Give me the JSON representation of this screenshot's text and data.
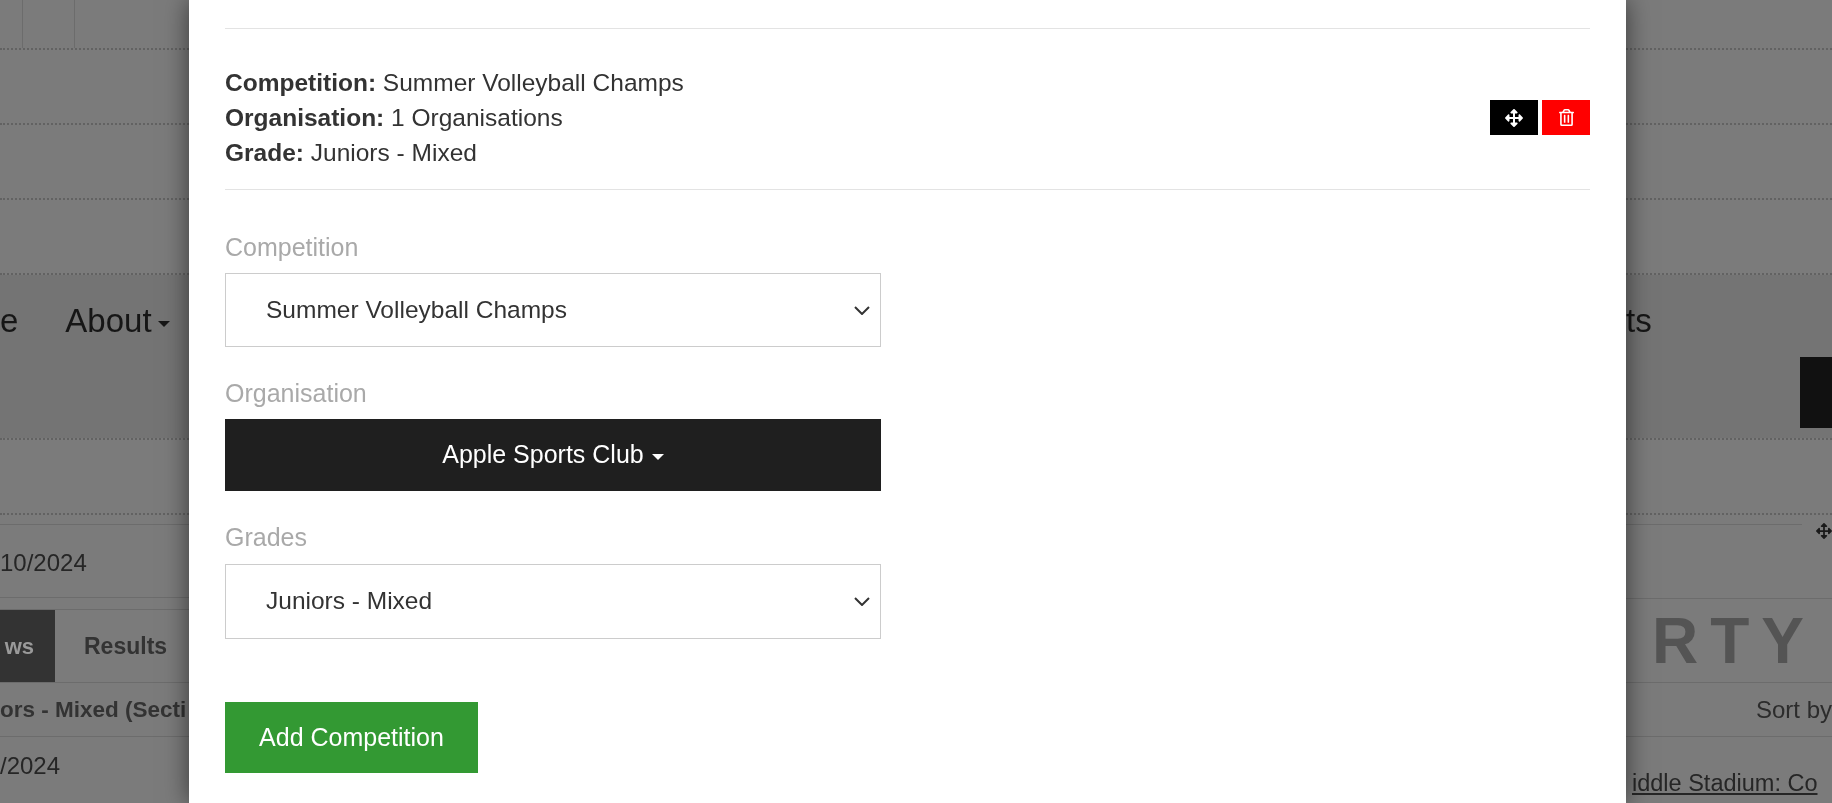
{
  "background_page": {
    "left": {
      "nav_fragment": "e",
      "nav_item": "About",
      "date": "10/2024",
      "tabs": [
        {
          "label": "ws",
          "selected": true
        },
        {
          "label": "Results",
          "selected": false
        }
      ],
      "heading": "ors - Mixed (Secti",
      "row_date": "/2024"
    },
    "right": {
      "nav_fragment": "ts",
      "banner": "RTY",
      "sort_label": "Sort by",
      "venue_link": "iddle Stadium: Co"
    }
  },
  "modal": {
    "summary": [
      "**Competition:** Summer Volleyball Champs",
      "**Organisation:** 1 Organisations",
      "**Grade:** Juniors - Mixed"
    ],
    "actions": [
      {
        "kind": "move"
      },
      {
        "kind": "delete"
      }
    ],
    "fields": [
      {
        "kind": "select",
        "label": "Competition",
        "value": "Summer Volleyball Champs"
      },
      {
        "kind": "dropdown",
        "label": "Organisation",
        "value": "Apple Sports Club"
      },
      {
        "kind": "select",
        "label": "Grades",
        "value": "Juniors - Mixed"
      }
    ],
    "submit": "Add Competition"
  }
}
